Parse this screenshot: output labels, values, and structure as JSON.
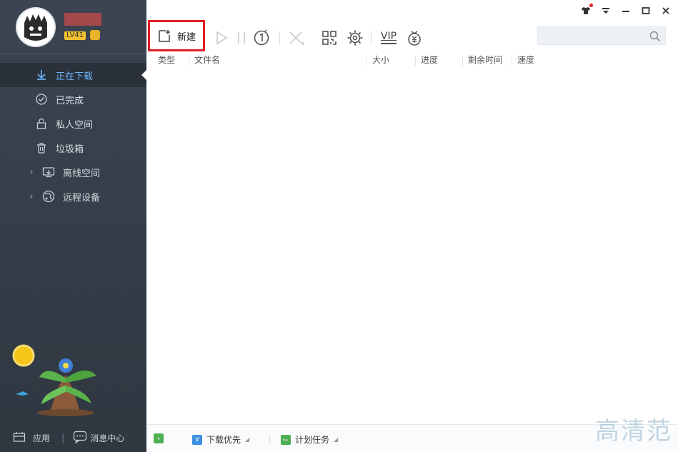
{
  "sidebar": {
    "level_text": "LV41",
    "items": [
      {
        "label": "正在下载",
        "icon": "download-arrow-icon",
        "active": true
      },
      {
        "label": "已完成",
        "icon": "check-circle-icon",
        "active": false
      },
      {
        "label": "私人空间",
        "icon": "lock-icon",
        "active": false
      },
      {
        "label": "垃圾箱",
        "icon": "trash-icon",
        "active": false
      },
      {
        "label": "离线空间",
        "icon": "cloud-download-icon",
        "active": false,
        "expandable": true
      },
      {
        "label": "远程设备",
        "icon": "remote-device-icon",
        "active": false,
        "expandable": true
      }
    ],
    "bottom": {
      "apps_label": "应用",
      "messages_label": "消息中心"
    }
  },
  "toolbar": {
    "new_label": "新建",
    "vip_label": "VIP"
  },
  "table": {
    "columns": [
      "类型",
      "文件名",
      "大小",
      "进度",
      "剩余时间",
      "速度"
    ]
  },
  "status_bar": {
    "priority_label": "下载优先",
    "schedule_label": "计划任务"
  },
  "watermark": {
    "text": "高清范"
  },
  "colors": {
    "sidebar_bg": "#3b4450",
    "active_text": "#6cb7ff",
    "highlight_box": "#e01e26"
  }
}
